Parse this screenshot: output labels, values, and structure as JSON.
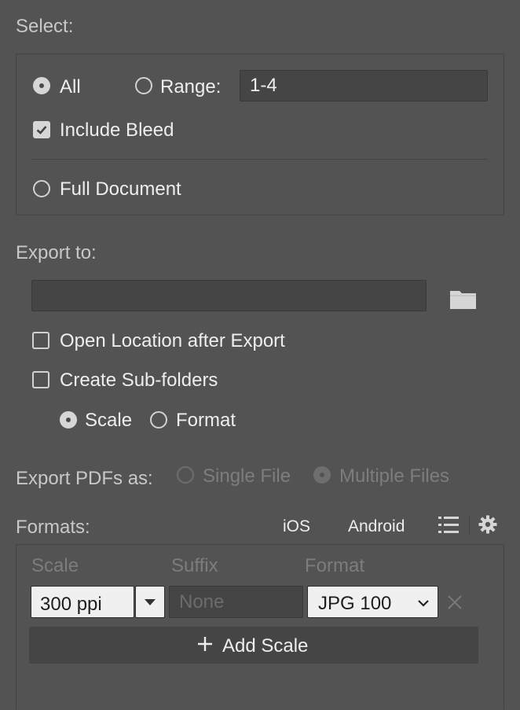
{
  "select": {
    "heading": "Select:",
    "all_label": "All",
    "range_label": "Range:",
    "range_value": "1-4",
    "include_bleed_label": "Include Bleed",
    "full_document_label": "Full Document"
  },
  "export_to": {
    "heading": "Export to:",
    "path_value": "",
    "open_location_label": "Open Location after Export",
    "create_subfolders_label": "Create Sub-folders",
    "scale_option": "Scale",
    "format_option": "Format"
  },
  "export_pdfs": {
    "label": "Export PDFs as:",
    "single_file": "Single File",
    "multiple_files": "Multiple Files"
  },
  "formats": {
    "heading": "Formats:",
    "ios_label": "iOS",
    "android_label": "Android",
    "columns": [
      "Scale",
      "Suffix",
      "Format"
    ],
    "row": {
      "scale": "300 ppi",
      "suffix_placeholder": "None",
      "format": "JPG 100"
    },
    "add_scale_label": "Add Scale"
  },
  "state": {
    "select_mode": "all",
    "include_bleed": true,
    "open_location": false,
    "create_subfolders": false,
    "subfolder_by": "scale",
    "pdf_mode": "multiple"
  }
}
